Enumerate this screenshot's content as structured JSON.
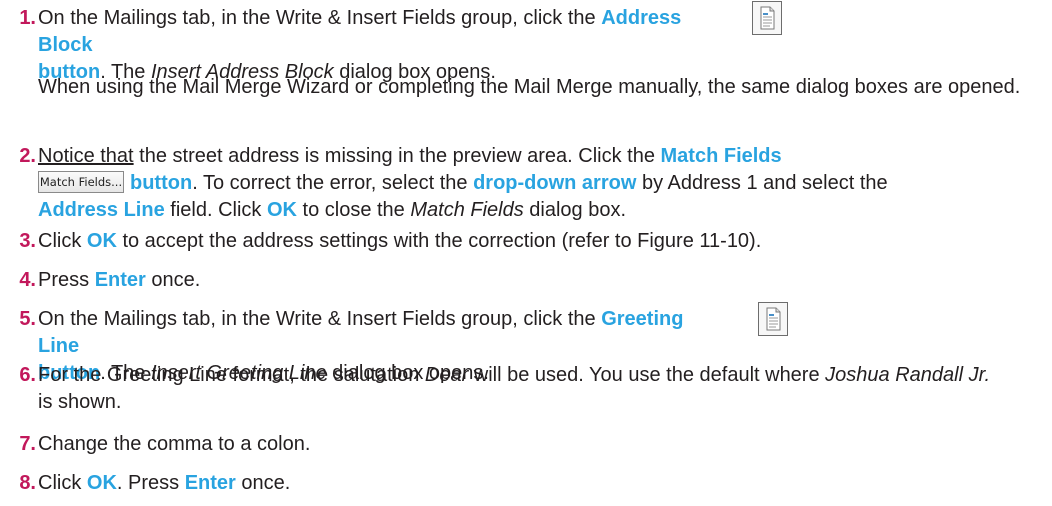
{
  "steps": [
    {
      "num": "1.",
      "p1": "On the Mailings tab, in the Write & Insert Fields group, click the ",
      "h1": "Address Block",
      "h2": "button",
      "p2": ". The ",
      "i1": "Insert Address Block",
      "p3": " dialog box opens.",
      "note": "When using the Mail Merge Wizard or completing the Mail Merge manually, the same dialog boxes are opened."
    },
    {
      "num": "2.",
      "u1": "Notice that",
      "p1": " the street address is missing in the preview area. Click the ",
      "h1": "Match Fields",
      "btn": "Match Fields...",
      "h2": "button",
      "p2": ". To correct the error, select the ",
      "h3": "drop-down arrow",
      "p3": " by Address 1 and select the ",
      "h4": "Address Line",
      "p4": " field. Click ",
      "h5": "OK",
      "p5": " to close the ",
      "i1": "Match Fields",
      "p6": " dialog box."
    },
    {
      "num": "3.",
      "p1": "Click ",
      "h1": "OK",
      "p2": " to accept the address settings with the correction (refer to Figure 11-10)."
    },
    {
      "num": "4.",
      "p1": "Press ",
      "h1": "Enter",
      "p2": " once."
    },
    {
      "num": "5.",
      "p1": "On the Mailings tab, in the Write & Insert Fields group, click the ",
      "h1": "Greeting Line",
      "h2": "button",
      "p2": ". The ",
      "i1": "Insert Greeting Line",
      "p3": " dialog box opens."
    },
    {
      "num": "6.",
      "p1": "For the Greeting Line format, the salutation ",
      "i1": "Dear",
      "p2": " will be used. You use the default where ",
      "i2": "Joshua Randall Jr.",
      "p3": " is shown."
    },
    {
      "num": "7.",
      "p1": "Change the comma to a colon."
    },
    {
      "num": "8.",
      "p1": "Click ",
      "h1": "OK",
      "p2": ". Press ",
      "h2": "Enter",
      "p3": " once."
    }
  ],
  "icons": {
    "address_block": "document-icon",
    "greeting_line": "document-icon"
  },
  "colors": {
    "step_number": "#c2185b",
    "highlight": "#29a3e0",
    "text": "#231f20"
  }
}
